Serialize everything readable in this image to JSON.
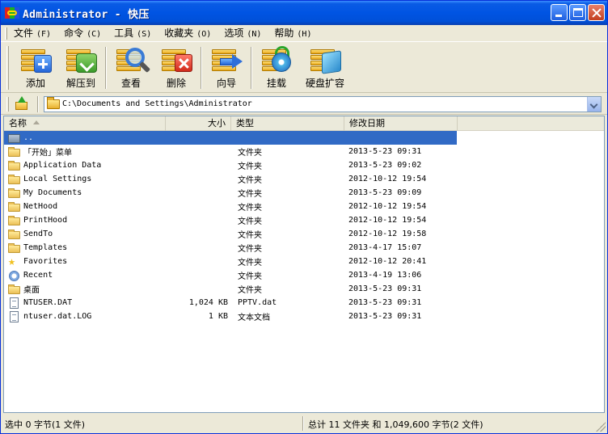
{
  "window": {
    "title": "Administrator - 快压"
  },
  "menu": [
    {
      "label": "文件",
      "acc": "(F)"
    },
    {
      "label": "命令",
      "acc": "(C)"
    },
    {
      "label": "工具",
      "acc": "(S)"
    },
    {
      "label": "收藏夹",
      "acc": "(O)"
    },
    {
      "label": "选项",
      "acc": "(N)"
    },
    {
      "label": "帮助",
      "acc": "(H)"
    }
  ],
  "toolbar": {
    "add": "添加",
    "extract": "解压到",
    "view": "查看",
    "delete": "删除",
    "wizard": "向导",
    "mount": "挂载",
    "disk_expand": "硬盘扩容"
  },
  "address": {
    "path": "C:\\Documents and Settings\\Administrator"
  },
  "columns": {
    "name": "名称",
    "size": "大小",
    "type": "类型",
    "modified": "修改日期"
  },
  "rows": [
    {
      "name": "..",
      "size": "",
      "type": "",
      "date": ""
    },
    {
      "name": "「开始」菜单",
      "size": "",
      "type": "文件夹",
      "date": "2013-5-23 09:31"
    },
    {
      "name": "Application Data",
      "size": "",
      "type": "文件夹",
      "date": "2013-5-23 09:02"
    },
    {
      "name": "Local Settings",
      "size": "",
      "type": "文件夹",
      "date": "2012-10-12 19:54"
    },
    {
      "name": "My Documents",
      "size": "",
      "type": "文件夹",
      "date": "2013-5-23 09:09"
    },
    {
      "name": "NetHood",
      "size": "",
      "type": "文件夹",
      "date": "2012-10-12 19:54"
    },
    {
      "name": "PrintHood",
      "size": "",
      "type": "文件夹",
      "date": "2012-10-12 19:54"
    },
    {
      "name": "SendTo",
      "size": "",
      "type": "文件夹",
      "date": "2012-10-12 19:58"
    },
    {
      "name": "Templates",
      "size": "",
      "type": "文件夹",
      "date": "2013-4-17 15:07"
    },
    {
      "name": "Favorites",
      "size": "",
      "type": "文件夹",
      "date": "2012-10-12 20:41"
    },
    {
      "name": "Recent",
      "size": "",
      "type": "文件夹",
      "date": "2013-4-19 13:06"
    },
    {
      "name": "桌面",
      "size": "",
      "type": "文件夹",
      "date": "2013-5-23 09:31"
    },
    {
      "name": "NTUSER.DAT",
      "size": "1,024 KB",
      "type": "PPTV.dat",
      "date": "2013-5-23 09:31"
    },
    {
      "name": "ntuser.dat.LOG",
      "size": "1 KB",
      "type": "文本文档",
      "date": "2013-5-23 09:31"
    }
  ],
  "status": {
    "selected": "选中  0 字节(1 文件)",
    "total": "总计 11 文件夹  和  1,049,600 字节(2 文件)"
  },
  "colors": {
    "title_bar": "#0054E3",
    "selection": "#316AC5",
    "chrome": "#ECE9D8"
  }
}
